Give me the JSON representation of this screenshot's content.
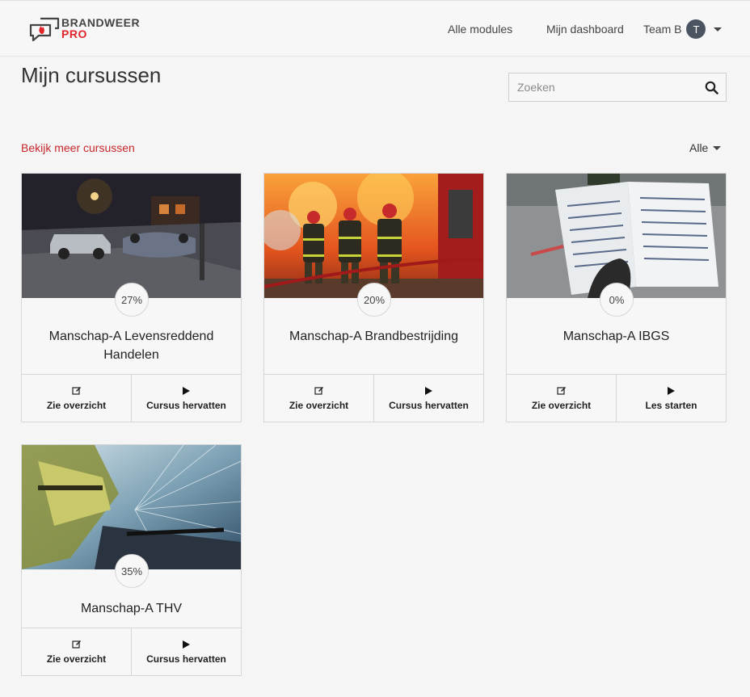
{
  "header": {
    "logo": {
      "line1": "BRANDWEER",
      "line2": "PRO"
    },
    "nav": {
      "modules": "Alle modules",
      "dashboard": "Mijn dashboard"
    },
    "user": {
      "name": "Team B",
      "initial": "T"
    }
  },
  "page": {
    "title": "Mijn cursussen",
    "search_placeholder": "Zoeken",
    "more_link": "Bekijk meer cursussen",
    "filter_label": "Alle"
  },
  "colors": {
    "accent": "#c8272b",
    "avatar": "#4a5561"
  },
  "courses": [
    {
      "title": "Manschap-A Levensreddend Handelen",
      "progress": "27%",
      "progress_value": 0.27,
      "action1": "Zie overzicht",
      "action2": "Cursus hervatten",
      "image": "car-crash-photo"
    },
    {
      "title": "Manschap-A Brandbestrijding",
      "progress": "20%",
      "progress_value": 0.2,
      "action1": "Zie overzicht",
      "action2": "Cursus hervatten",
      "image": "firefighters-photo"
    },
    {
      "title": "Manschap-A IBGS",
      "progress": "0%",
      "progress_value": 0.0,
      "action1": "Zie overzicht",
      "action2": "Les starten",
      "image": "hazmat-booklet-photo"
    },
    {
      "title": "Manschap-A THV",
      "progress": "35%",
      "progress_value": 0.35,
      "action1": "Zie overzicht",
      "action2": "Cursus hervatten",
      "image": "glass-cutting-photo"
    }
  ]
}
